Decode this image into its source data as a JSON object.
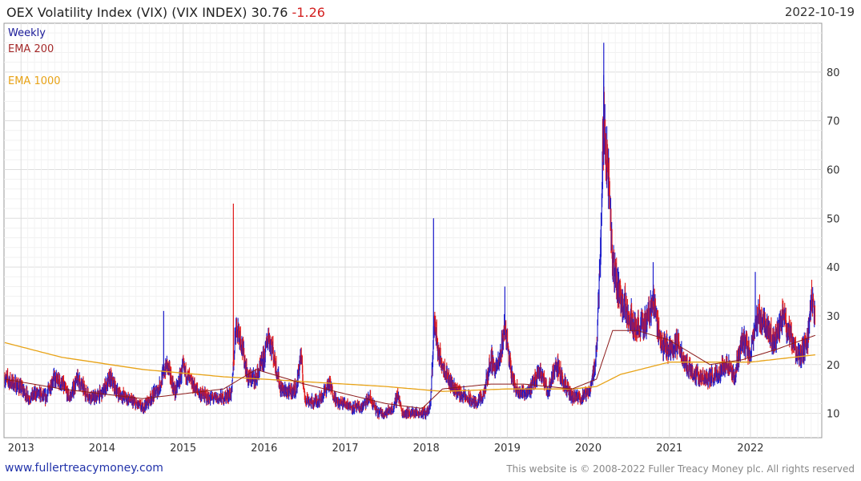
{
  "header": {
    "title": "OEX Volatility Index (VIX) (VIX INDEX)",
    "last": "30.76",
    "change": "-1.26",
    "date": "2022-10-19"
  },
  "footer": {
    "site": "www.fullertreacymoney.com",
    "copyright": "This website is © 2008-2022 Fuller Treacy Money plc. All rights reserved"
  },
  "colors": {
    "up": "#1a1acc",
    "down": "#e01818",
    "ema200": "#8b1a1a",
    "ema1000": "#e8a317",
    "grid": "#dddddd",
    "frame": "#999999"
  },
  "chart_data": {
    "type": "line",
    "legend": [
      "Weekly",
      "EMA 200",
      "EMA 1000"
    ],
    "x_ticks": [
      "2013",
      "2014",
      "2015",
      "2016",
      "2017",
      "2018",
      "2019",
      "2020",
      "2021",
      "2022"
    ],
    "y_ticks": [
      "10",
      "20",
      "30",
      "40",
      "50",
      "60",
      "70",
      "80"
    ],
    "xlim": [
      2012.79,
      2022.88
    ],
    "ylim": [
      5,
      90
    ],
    "price_keypoints": [
      [
        2012.8,
        17
      ],
      [
        2012.9,
        16
      ],
      [
        2013.0,
        15
      ],
      [
        2013.1,
        13
      ],
      [
        2013.2,
        14
      ],
      [
        2013.3,
        13
      ],
      [
        2013.4,
        17
      ],
      [
        2013.5,
        16
      ],
      [
        2013.6,
        13
      ],
      [
        2013.7,
        17
      ],
      [
        2013.8,
        14
      ],
      [
        2013.9,
        13
      ],
      [
        2014.0,
        14
      ],
      [
        2014.1,
        17
      ],
      [
        2014.2,
        14
      ],
      [
        2014.3,
        13
      ],
      [
        2014.4,
        12
      ],
      [
        2014.5,
        11
      ],
      [
        2014.6,
        13
      ],
      [
        2014.7,
        15
      ],
      [
        2014.8,
        20
      ],
      [
        2014.9,
        14
      ],
      [
        2015.0,
        19
      ],
      [
        2015.1,
        16
      ],
      [
        2015.2,
        14
      ],
      [
        2015.3,
        13
      ],
      [
        2015.4,
        13
      ],
      [
        2015.5,
        13
      ],
      [
        2015.6,
        14
      ],
      [
        2015.65,
        28
      ],
      [
        2015.7,
        26
      ],
      [
        2015.8,
        17
      ],
      [
        2015.9,
        17
      ],
      [
        2016.0,
        21
      ],
      [
        2016.05,
        26
      ],
      [
        2016.1,
        23
      ],
      [
        2016.2,
        15
      ],
      [
        2016.3,
        14
      ],
      [
        2016.4,
        15
      ],
      [
        2016.45,
        22
      ],
      [
        2016.5,
        13
      ],
      [
        2016.6,
        12
      ],
      [
        2016.7,
        13
      ],
      [
        2016.8,
        16
      ],
      [
        2016.9,
        12
      ],
      [
        2017.0,
        12
      ],
      [
        2017.1,
        11
      ],
      [
        2017.2,
        11
      ],
      [
        2017.3,
        13
      ],
      [
        2017.4,
        10
      ],
      [
        2017.5,
        10
      ],
      [
        2017.6,
        11
      ],
      [
        2017.65,
        14
      ],
      [
        2017.7,
        10
      ],
      [
        2017.8,
        10
      ],
      [
        2017.9,
        10
      ],
      [
        2018.0,
        10
      ],
      [
        2018.05,
        11
      ],
      [
        2018.1,
        29
      ],
      [
        2018.15,
        22
      ],
      [
        2018.2,
        20
      ],
      [
        2018.3,
        16
      ],
      [
        2018.4,
        14
      ],
      [
        2018.5,
        13
      ],
      [
        2018.6,
        12
      ],
      [
        2018.7,
        13
      ],
      [
        2018.8,
        21
      ],
      [
        2018.85,
        19
      ],
      [
        2018.9,
        20
      ],
      [
        2018.97,
        28
      ],
      [
        2019.05,
        18
      ],
      [
        2019.1,
        15
      ],
      [
        2019.2,
        14
      ],
      [
        2019.3,
        15
      ],
      [
        2019.4,
        19
      ],
      [
        2019.5,
        14
      ],
      [
        2019.6,
        20
      ],
      [
        2019.7,
        16
      ],
      [
        2019.8,
        13
      ],
      [
        2019.9,
        13
      ],
      [
        2020.0,
        14
      ],
      [
        2020.05,
        17
      ],
      [
        2020.1,
        22
      ],
      [
        2020.15,
        45
      ],
      [
        2020.19,
        70
      ],
      [
        2020.24,
        60
      ],
      [
        2020.3,
        40
      ],
      [
        2020.4,
        33
      ],
      [
        2020.5,
        30
      ],
      [
        2020.6,
        27
      ],
      [
        2020.7,
        28
      ],
      [
        2020.8,
        33
      ],
      [
        2020.9,
        24
      ],
      [
        2021.0,
        23
      ],
      [
        2021.1,
        24
      ],
      [
        2021.2,
        20
      ],
      [
        2021.3,
        18
      ],
      [
        2021.4,
        17
      ],
      [
        2021.5,
        17
      ],
      [
        2021.6,
        18
      ],
      [
        2021.7,
        20
      ],
      [
        2021.8,
        17
      ],
      [
        2021.9,
        25
      ],
      [
        2022.0,
        22
      ],
      [
        2022.1,
        30
      ],
      [
        2022.2,
        28
      ],
      [
        2022.3,
        24
      ],
      [
        2022.4,
        30
      ],
      [
        2022.5,
        25
      ],
      [
        2022.6,
        21
      ],
      [
        2022.7,
        24
      ],
      [
        2022.75,
        32
      ],
      [
        2022.8,
        31
      ]
    ],
    "spikes": [
      [
        2015.62,
        53
      ],
      [
        2018.09,
        50
      ],
      [
        2020.19,
        86
      ],
      [
        2020.8,
        41
      ],
      [
        2014.76,
        31
      ],
      [
        2018.97,
        36
      ],
      [
        2022.06,
        39
      ]
    ],
    "ema200_keypoints": [
      [
        2012.8,
        17
      ],
      [
        2013.5,
        15
      ],
      [
        2014.5,
        13
      ],
      [
        2015.5,
        15
      ],
      [
        2015.9,
        19
      ],
      [
        2016.5,
        16
      ],
      [
        2017.5,
        12
      ],
      [
        2017.95,
        11
      ],
      [
        2018.2,
        15
      ],
      [
        2018.8,
        16
      ],
      [
        2019.2,
        16
      ],
      [
        2019.8,
        15
      ],
      [
        2020.1,
        17
      ],
      [
        2020.3,
        27
      ],
      [
        2020.6,
        27
      ],
      [
        2021.0,
        25
      ],
      [
        2021.5,
        20
      ],
      [
        2021.9,
        21
      ],
      [
        2022.3,
        23
      ],
      [
        2022.8,
        26
      ]
    ],
    "ema1000_keypoints": [
      [
        2012.8,
        24.5
      ],
      [
        2013.5,
        21.5
      ],
      [
        2014.5,
        19
      ],
      [
        2015.5,
        17.5
      ],
      [
        2016.5,
        16.5
      ],
      [
        2017.5,
        15.5
      ],
      [
        2018.2,
        14.5
      ],
      [
        2019.0,
        15
      ],
      [
        2019.8,
        15
      ],
      [
        2020.1,
        15.5
      ],
      [
        2020.4,
        18
      ],
      [
        2021.0,
        20.5
      ],
      [
        2021.5,
        20.5
      ],
      [
        2022.0,
        20.5
      ],
      [
        2022.8,
        22
      ]
    ]
  }
}
